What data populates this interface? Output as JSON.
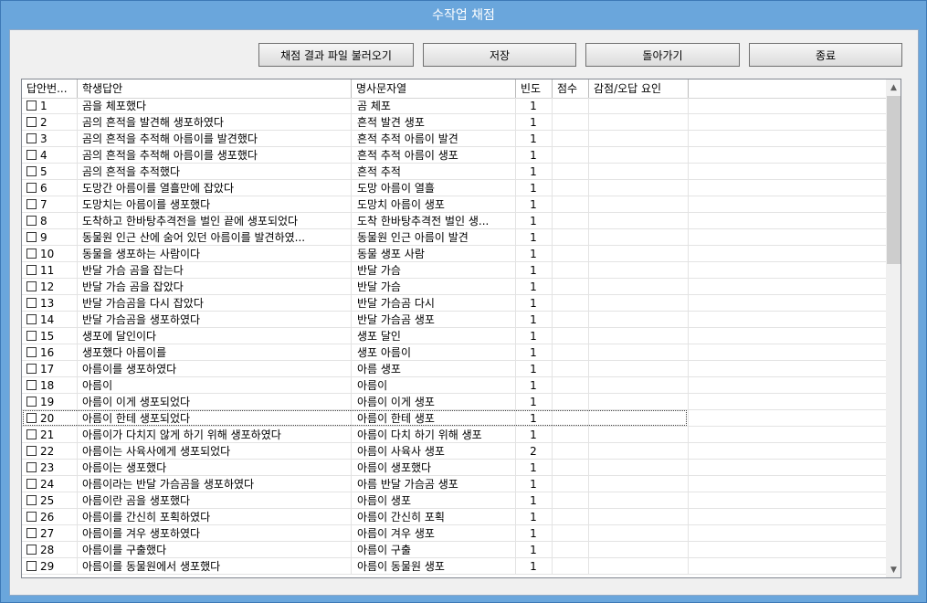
{
  "window": {
    "title": "수작업 채점"
  },
  "toolbar": {
    "load_label": "채점 결과 파일 불러오기",
    "save_label": "저장",
    "back_label": "돌아가기",
    "exit_label": "종료"
  },
  "table": {
    "columns": [
      "답안번...",
      "학생답안",
      "명사문자열",
      "빈도",
      "점수",
      "감점/오답 요인"
    ],
    "rows": [
      {
        "num": "1",
        "answer": "곰을 체포했다",
        "nouns": "곰 체포",
        "freq": "1"
      },
      {
        "num": "2",
        "answer": "곰의 흔적을 발견해 생포하였다",
        "nouns": "흔적 발견 생포",
        "freq": "1"
      },
      {
        "num": "3",
        "answer": "곰의 흔적을 추적해 아름이를 발견했다",
        "nouns": "흔적 추적 아름이 발견",
        "freq": "1"
      },
      {
        "num": "4",
        "answer": "곰의 흔적을 추적해 아름이를 생포했다",
        "nouns": "흔적 추적 아름이 생포",
        "freq": "1"
      },
      {
        "num": "5",
        "answer": "곰의 흔적을 추적했다",
        "nouns": "흔적 추적",
        "freq": "1"
      },
      {
        "num": "6",
        "answer": "도망간 아름이를 열흘만에 잡았다",
        "nouns": "도망 아름이 열흘",
        "freq": "1"
      },
      {
        "num": "7",
        "answer": "도망치는 아름이를 생포했다",
        "nouns": "도망치 아름이 생포",
        "freq": "1"
      },
      {
        "num": "8",
        "answer": "도착하고 한바탕추격전을 벌인 끝에 생포되었다",
        "nouns": "도착 한바탕추격전 벌인 생...",
        "freq": "1"
      },
      {
        "num": "9",
        "answer": "동물원 인근 산에 숨어 있던 아름이를 발견하였...",
        "nouns": "동물원 인근 아름이 발견",
        "freq": "1"
      },
      {
        "num": "10",
        "answer": "동물을 생포하는 사람이다",
        "nouns": "동물 생포 사람",
        "freq": "1"
      },
      {
        "num": "11",
        "answer": "반달 가슴 곰을 잡는다",
        "nouns": "반달 가슴",
        "freq": "1"
      },
      {
        "num": "12",
        "answer": "반달 가슴 곰을 잡았다",
        "nouns": "반달 가슴",
        "freq": "1"
      },
      {
        "num": "13",
        "answer": "반달 가슴곰을 다시 잡았다",
        "nouns": "반달 가슴곰 다시",
        "freq": "1"
      },
      {
        "num": "14",
        "answer": "반달 가슴곰을 생포하였다",
        "nouns": "반달 가슴곰 생포",
        "freq": "1"
      },
      {
        "num": "15",
        "answer": "생포에 달인이다",
        "nouns": "생포 달인",
        "freq": "1"
      },
      {
        "num": "16",
        "answer": "생포했다 아름이를",
        "nouns": "생포 아름이",
        "freq": "1"
      },
      {
        "num": "17",
        "answer": "아름이를 생포하였다",
        "nouns": "아름 생포",
        "freq": "1"
      },
      {
        "num": "18",
        "answer": "아름이",
        "nouns": "아름이",
        "freq": "1"
      },
      {
        "num": "19",
        "answer": "아름이 이게 생포되었다",
        "nouns": "아름이 이게 생포",
        "freq": "1"
      },
      {
        "num": "20",
        "answer": "아름이 한테 생포되었다",
        "nouns": "아름이 한테 생포",
        "freq": "1"
      },
      {
        "num": "21",
        "answer": "아름이가 다치지 않게 하기 위해 생포하였다",
        "nouns": "아름이 다치 하기 위해 생포",
        "freq": "1"
      },
      {
        "num": "22",
        "answer": "아름이는 사육사에게 생포되었다",
        "nouns": "아름이 사육사 생포",
        "freq": "2"
      },
      {
        "num": "23",
        "answer": "아름이는 생포했다",
        "nouns": "아름이 생포했다",
        "freq": "1"
      },
      {
        "num": "24",
        "answer": "아름이라는 반달 가슴곰을 생포하였다",
        "nouns": "아름 반달 가슴곰 생포",
        "freq": "1"
      },
      {
        "num": "25",
        "answer": "아름이란 곰을 생포했다",
        "nouns": "아름이 생포",
        "freq": "1"
      },
      {
        "num": "26",
        "answer": "아름이를 간신히 포획하였다",
        "nouns": "아름이 간신히 포획",
        "freq": "1"
      },
      {
        "num": "27",
        "answer": "아름이를 겨우 생포하였다",
        "nouns": "아름이 겨우 생포",
        "freq": "1"
      },
      {
        "num": "28",
        "answer": "아름이를 구출했다",
        "nouns": "아름이 구출",
        "freq": "1"
      },
      {
        "num": "29",
        "answer": "아름이를 동물원에서 생포했다",
        "nouns": "아름이 동물원 생포",
        "freq": "1"
      }
    ]
  },
  "scrollbar": {
    "up_icon": "▲",
    "down_icon": "▼"
  }
}
